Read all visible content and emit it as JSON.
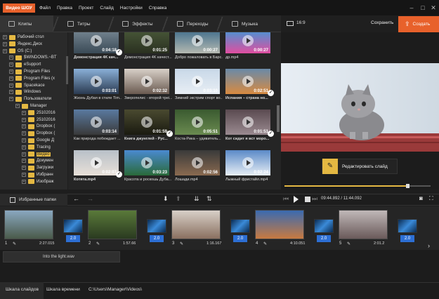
{
  "app": {
    "logo": "Видео ШОУ"
  },
  "menu": [
    "Файл",
    "Правка",
    "Проект",
    "Слайд",
    "Настройки",
    "Справка"
  ],
  "tabs": [
    {
      "label": "Клипы",
      "icon": "film-icon",
      "active": true
    },
    {
      "label": "Титры",
      "icon": "text-icon"
    },
    {
      "label": "Эффекты",
      "icon": "star-icon"
    },
    {
      "label": "Переходы",
      "icon": "transition-icon"
    },
    {
      "label": "Музыка",
      "icon": "music-icon"
    }
  ],
  "header": {
    "ratio": "16:9",
    "save_label": "Сохранить",
    "create_label": "Создать"
  },
  "tree": [
    {
      "label": "Рабочий стол",
      "depth": 1
    },
    {
      "label": "Яндекс.Диск",
      "depth": 1
    },
    {
      "label": "OS (C:)",
      "depth": 1
    },
    {
      "label": "$WINDOWS.~BT",
      "depth": 2
    },
    {
      "label": "eSupport",
      "depth": 2
    },
    {
      "label": "Program Files",
      "depth": 2
    },
    {
      "label": "Program Files (x",
      "depth": 2
    },
    {
      "label": "Spacekace",
      "depth": 2
    },
    {
      "label": "Windows",
      "depth": 2
    },
    {
      "label": "Пользователи",
      "depth": 2
    },
    {
      "label": "Manager",
      "depth": 3
    },
    {
      "label": "25102016",
      "depth": 4
    },
    {
      "label": "25102016",
      "depth": 4
    },
    {
      "label": "Dropbox (",
      "depth": 4
    },
    {
      "label": "Dropbox (",
      "depth": 4
    },
    {
      "label": "Google Д",
      "depth": 4
    },
    {
      "label": "Tracing",
      "depth": 4
    },
    {
      "label": "Видео",
      "depth": 4,
      "selected": true
    },
    {
      "label": "Докумен",
      "depth": 4
    },
    {
      "label": "Загрузки",
      "depth": 4
    },
    {
      "label": "Избранн",
      "depth": 4
    },
    {
      "label": "Изображ",
      "depth": 4
    }
  ],
  "clips": [
    {
      "duration": "0:04:18",
      "caption": "Демонстрация 4K кач...",
      "check": true,
      "colors": [
        "#7a8a96",
        "#3a4a56"
      ]
    },
    {
      "duration": "0:01:25",
      "caption": "Демонстрация 4K качест...",
      "colors": [
        "#4a5a3a",
        "#2a3020"
      ]
    },
    {
      "duration": "0:00:27",
      "caption": "Добро пожаловать в Барс...",
      "colors": [
        "#3a6a8a",
        "#b4b8b0"
      ]
    },
    {
      "duration": "0:00:27",
      "caption": "др.mp4",
      "colors": [
        "#3a9ad8",
        "#e04ea0"
      ]
    },
    {
      "duration": "0:03:01",
      "caption": "Жизнь Дубая в стиле Tim...",
      "colors": [
        "#8ab0d8",
        "#2a3a50"
      ]
    },
    {
      "duration": "0:02:32",
      "caption": "Зверопелис - второй треi...",
      "colors": [
        "#d8d0c8",
        "#6a5a50"
      ]
    },
    {
      "duration": "0:03:10",
      "caption": "Зимний экстрим спорт во...",
      "colors": [
        "#c8d8e8",
        "#e8eef4"
      ]
    },
    {
      "duration": "0:02:51",
      "caption": "Испания – страна но...",
      "check": true,
      "colors": [
        "#6a8aa8",
        "#d88a40"
      ]
    },
    {
      "duration": "0:03:14",
      "caption": "Как природа побеждает ...",
      "colors": [
        "#5a7aa0",
        "#3a3a3a"
      ]
    },
    {
      "duration": "0:01:59",
      "caption": "Книга джунглей - Рус...",
      "check": true,
      "colors": [
        "#4a4a30",
        "#1a1a10"
      ]
    },
    {
      "duration": "0:05:51",
      "caption": "Коста-Рика – удивитель...",
      "colors": [
        "#3a5a30",
        "#6a8a50"
      ]
    },
    {
      "duration": "0:01:51",
      "caption": "Кот сидит я вст моро...",
      "check": true,
      "colors": [
        "#5a4a50",
        "#9a8a90"
      ]
    },
    {
      "duration": "0:02:07",
      "caption": "Котята.mp4",
      "check": true,
      "colors": [
        "#b8c0c8",
        "#e8e0d8"
      ]
    },
    {
      "duration": "0:03:23",
      "caption": "Красота и роскошь Дуба...",
      "colors": [
        "#4a8ad0",
        "#2a6a3a"
      ]
    },
    {
      "duration": "0:02:56",
      "caption": "Лошади.mp4",
      "colors": [
        "#3a3a3a",
        "#8a6a50"
      ]
    },
    {
      "duration": "0:02:24",
      "caption": "Лыжный фристайл.mp4",
      "colors": [
        "#5a8ac8",
        "#e8eef4"
      ]
    }
  ],
  "preview": {
    "edit_label": "Редактировать слайд",
    "progress": 0.84
  },
  "favorites_label": "Избранные папки",
  "time": "09:44.892 / 11:44.092",
  "timeline": [
    {
      "num": "1",
      "duration": "2:27.015",
      "trans": "2.0",
      "colors": [
        "#8aa8c0",
        "#4a5a4a"
      ]
    },
    {
      "num": "2",
      "duration": "1:57.66",
      "trans": "2.0",
      "colors": [
        "#5a7a3a",
        "#2a3a20"
      ]
    },
    {
      "num": "3",
      "duration": "1:16.167",
      "trans": "2.0",
      "colors": [
        "#d8d0c8",
        "#8a7060"
      ]
    },
    {
      "num": "4",
      "duration": "4:10.051",
      "trans": "2.0",
      "colors": [
        "#3a6ab0",
        "#c87a40"
      ]
    },
    {
      "num": "5",
      "duration": "2:01.2",
      "trans": "2.0",
      "colors": [
        "#c0b8b8",
        "#6a5a5a"
      ]
    }
  ],
  "audio": {
    "file": "Into the light.wav"
  },
  "bottom": {
    "tab1": "Шкала слайдов",
    "tab2": "Шкала времени",
    "path": "C:\\Users\\Manager\\Videos\\"
  }
}
